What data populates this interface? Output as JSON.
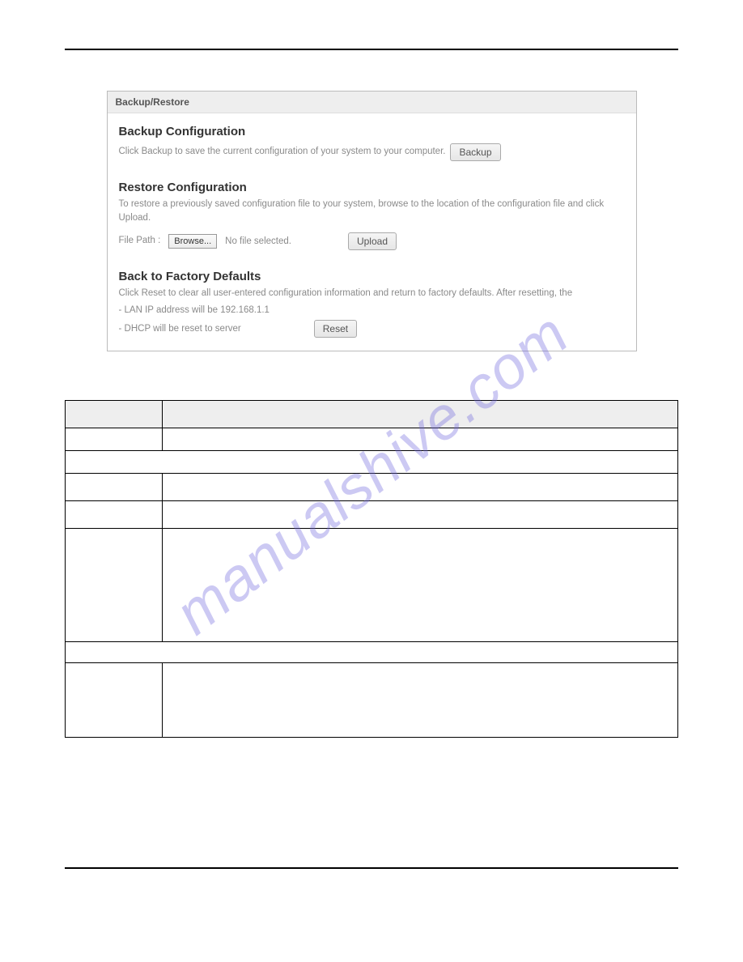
{
  "panel": {
    "title": "Backup/Restore",
    "backup": {
      "heading": "Backup Configuration",
      "desc": "Click Backup to save the current configuration of your system to your computer.",
      "button": "Backup"
    },
    "restore": {
      "heading": "Restore Configuration",
      "desc": "To restore a previously saved configuration file to your system, browse to the location of the configuration file and click Upload.",
      "filepath_label": "File Path :",
      "browse_button": "Browse...",
      "nofile": "No file selected.",
      "upload_button": "Upload"
    },
    "defaults": {
      "heading": "Back to Factory Defaults",
      "desc": "Click Reset to clear all user-entered configuration information and return to factory defaults. After resetting, the",
      "line1": "- LAN IP address will be 192.168.1.1",
      "line2": "- DHCP will be reset to server",
      "reset_button": "Reset"
    }
  },
  "watermark": "manualshive.com"
}
